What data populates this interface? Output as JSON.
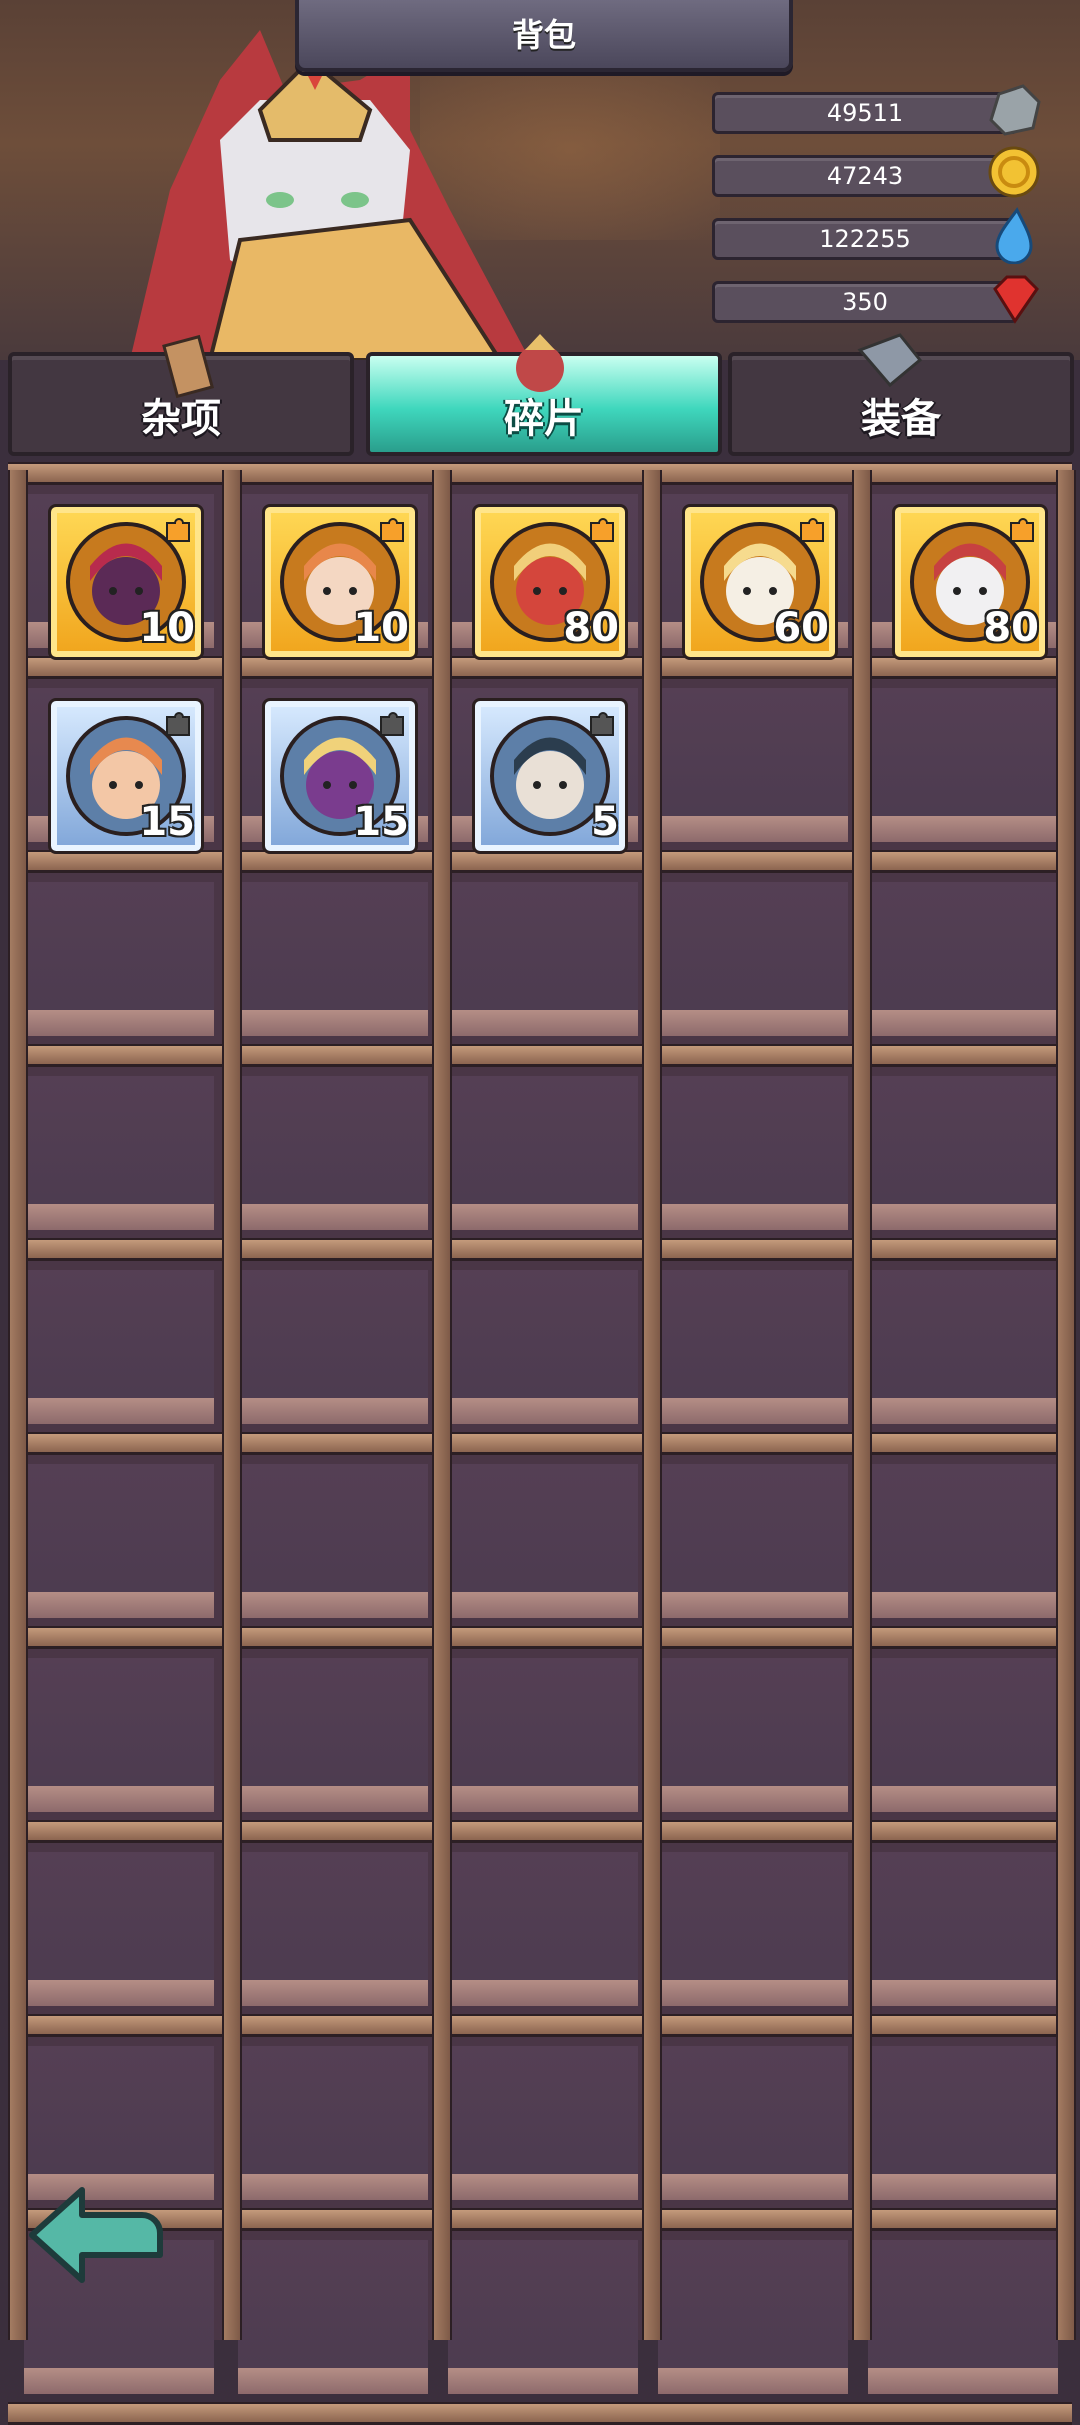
{
  "title": "背包",
  "resources": [
    {
      "name": "stone",
      "value": "49511",
      "icon": "stone-icon"
    },
    {
      "name": "coin",
      "value": "47243",
      "icon": "gold-coin-icon"
    },
    {
      "name": "water",
      "value": "122255",
      "icon": "water-drop-icon"
    },
    {
      "name": "gem",
      "value": "350",
      "icon": "red-gem-icon"
    }
  ],
  "tabs": [
    {
      "label": "杂项",
      "active": false
    },
    {
      "label": "碎片",
      "active": true
    },
    {
      "label": "装备",
      "active": false
    }
  ],
  "items": [
    {
      "qty": "10",
      "rarity": "gold",
      "portrait": "red-hood-creature"
    },
    {
      "qty": "10",
      "rarity": "gold",
      "portrait": "orange-hair-heroine"
    },
    {
      "qty": "80",
      "rarity": "gold",
      "portrait": "blonde-scarf-hero"
    },
    {
      "qty": "60",
      "rarity": "gold",
      "portrait": "blonde-bandaged-hero"
    },
    {
      "qty": "80",
      "rarity": "gold",
      "portrait": "cat-warrior"
    },
    {
      "qty": "15",
      "rarity": "blue",
      "portrait": "freckled-boy"
    },
    {
      "qty": "15",
      "rarity": "blue",
      "portrait": "masked-purple-hero"
    },
    {
      "qty": "5",
      "rarity": "blue",
      "portrait": "dark-hair-hero"
    }
  ],
  "colors": {
    "gold_frame": "#ffd956",
    "blue_frame": "#d9ebff",
    "active_tab": "#3fd7bd",
    "back_arrow": "#55b8a6"
  }
}
